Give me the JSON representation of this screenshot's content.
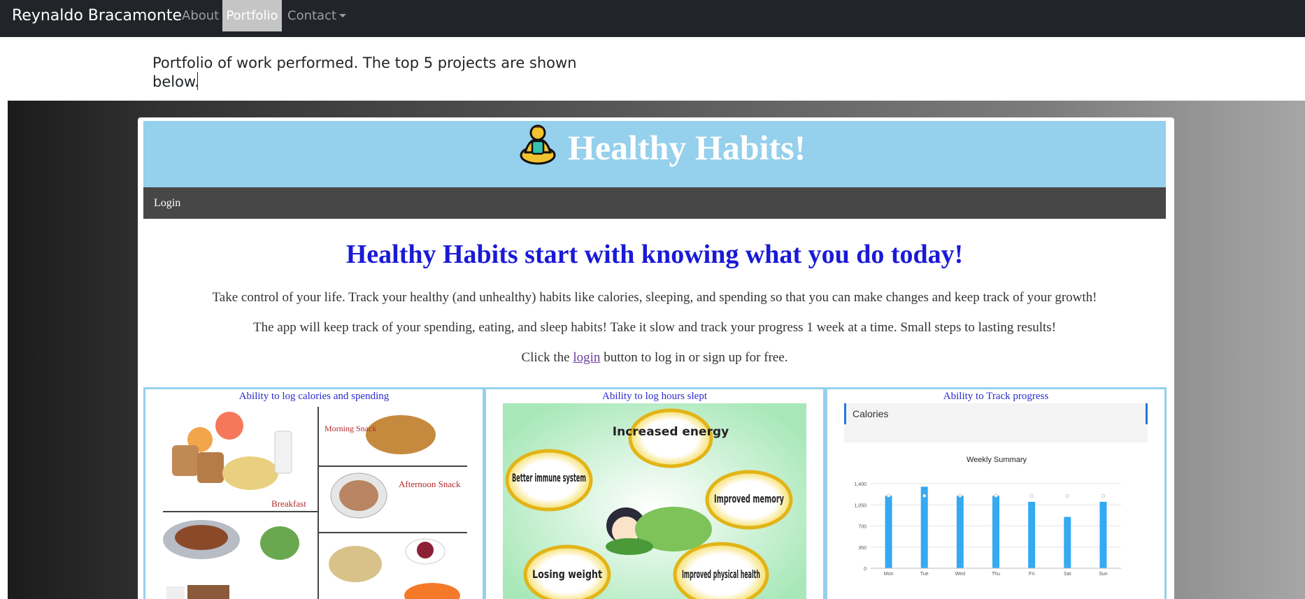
{
  "navbar": {
    "brand": "Reynaldo Bracamonte",
    "items": [
      {
        "label": "About"
      },
      {
        "label": "Portfolio",
        "active": true
      },
      {
        "label": "Contact",
        "dropdown": true
      }
    ]
  },
  "intro": "Portfolio of work performed. The top 5 projects are shown below.",
  "project": {
    "title": "Healthy Habits!",
    "nav_login": "Login",
    "headline": "Healthy Habits start with knowing what you do today!",
    "para1": "Take control of your life. Track your healthy (and unhealthy) habits like calories, sleeping, and spending so that you can make changes and keep track of your growth!",
    "para2": "The app will keep track of your spending, eating, and sleep habits! Take it slow and track your progress 1 week at a time. Small steps to lasting results!",
    "para3_pre": "Click the ",
    "para3_link": "login",
    "para3_post": " button to log in or sign up for free.",
    "features": [
      {
        "caption": "Ability to log calories and spending",
        "labels": [
          "Morning Snack",
          "Breakfast",
          "Afternoon Snack"
        ]
      },
      {
        "caption": "Ability to log hours slept",
        "bubbles": [
          "Increased energy",
          "Better immune system",
          "Improved memory",
          "Losing weight",
          "Improved physical health"
        ]
      },
      {
        "caption": "Ability to Track progress",
        "card_title": "Calories",
        "chart_title": "Weekly Summary"
      }
    ]
  },
  "chart_data": {
    "type": "bar",
    "title": "Weekly Summary",
    "categories": [
      "Mon",
      "Tue",
      "Wed",
      "Thu",
      "Fri",
      "Sat",
      "Sun"
    ],
    "values": [
      1200,
      1350,
      1200,
      1200,
      1100,
      850,
      1100
    ],
    "yticks": [
      "0",
      "350",
      "700",
      "1,050",
      "1,400"
    ],
    "ylim": [
      0,
      1400
    ],
    "color": "#35a9f2"
  },
  "colors": {
    "navbar": "#212529",
    "header_blue": "#95d0ec",
    "headline_blue": "#1a1ad6",
    "bar_blue": "#35a9f2"
  }
}
